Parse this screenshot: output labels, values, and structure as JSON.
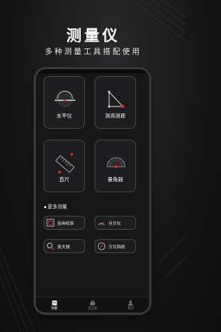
{
  "hero": {
    "title": "测量仪",
    "subtitle": "多种测量工具搭配使用"
  },
  "tools": [
    {
      "label": "水平仪",
      "icon": "level-icon"
    },
    {
      "label": "测高测距",
      "icon": "height-distance-icon"
    },
    {
      "label": "直尺",
      "icon": "ruler-icon"
    },
    {
      "label": "量角器",
      "icon": "protractor-icon"
    }
  ],
  "more": {
    "heading": "更多测量",
    "items": [
      {
        "label": "挂画校准",
        "icon": "frame-calibration-icon"
      },
      {
        "label": "分贝仪",
        "icon": "decibel-icon"
      },
      {
        "label": "放大镜",
        "icon": "magnifier-icon"
      },
      {
        "label": "方位指南",
        "icon": "compass-icon"
      }
    ]
  },
  "tabbar": {
    "items": [
      {
        "label": "测量",
        "icon": "measure-tab-icon",
        "active": true
      },
      {
        "label": "百宝箱",
        "icon": "toolbox-tab-icon",
        "active": false
      },
      {
        "label": "我的",
        "icon": "profile-tab-icon",
        "active": false
      }
    ]
  },
  "colors": {
    "accent": "#e0262a",
    "background": "#151516",
    "tile_border": "#4a4a4d"
  }
}
